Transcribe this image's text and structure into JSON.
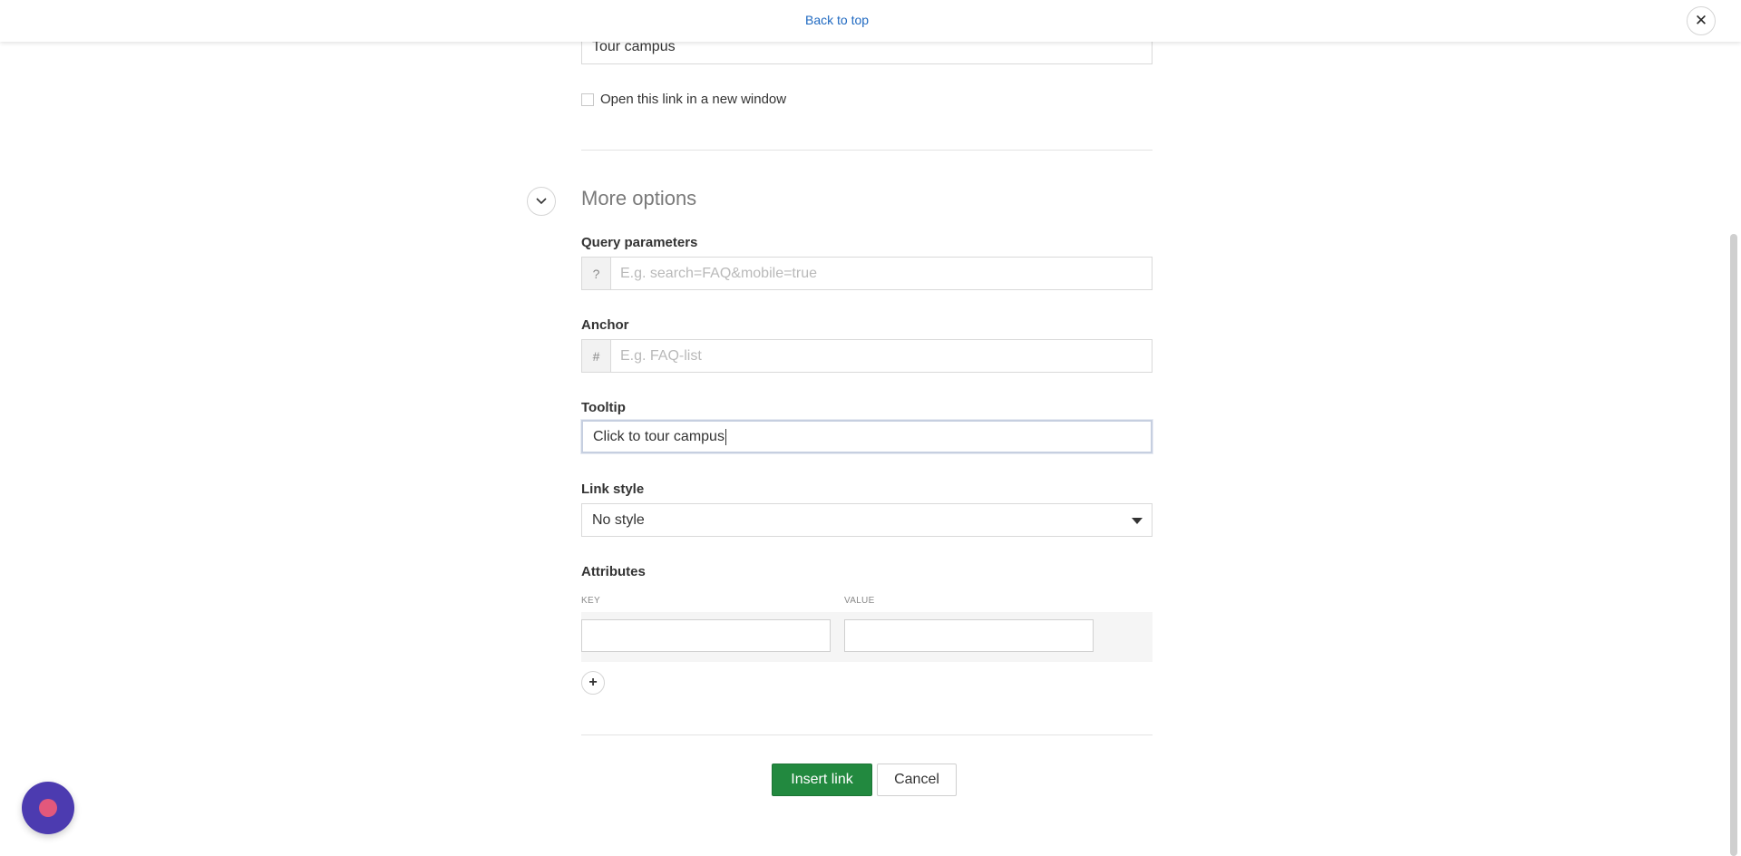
{
  "topbar": {
    "back_to_top": "Back to top",
    "close_icon": "close-icon"
  },
  "link": {
    "title_value": "Tour campus",
    "new_window_label": "Open this link in a new window",
    "new_window_checked": false
  },
  "more_options": {
    "title": "More options",
    "query": {
      "label": "Query parameters",
      "prefix": "?",
      "placeholder": "E.g. search=FAQ&mobile=true"
    },
    "anchor": {
      "label": "Anchor",
      "prefix": "#",
      "placeholder": "E.g. FAQ-list"
    },
    "tooltip": {
      "label": "Tooltip",
      "value": "Click to tour campus"
    },
    "link_style": {
      "label": "Link style",
      "selected": "No style"
    },
    "attributes": {
      "label": "Attributes",
      "key_header": "KEY",
      "value_header": "VALUE",
      "key_value": "",
      "value_value": ""
    }
  },
  "actions": {
    "insert_label": "Insert link",
    "cancel_label": "Cancel"
  },
  "colors": {
    "accent": "#22893f",
    "link": "#1f69c1",
    "chat": "#4c3bb0",
    "chat_dot": "#e2587c"
  }
}
